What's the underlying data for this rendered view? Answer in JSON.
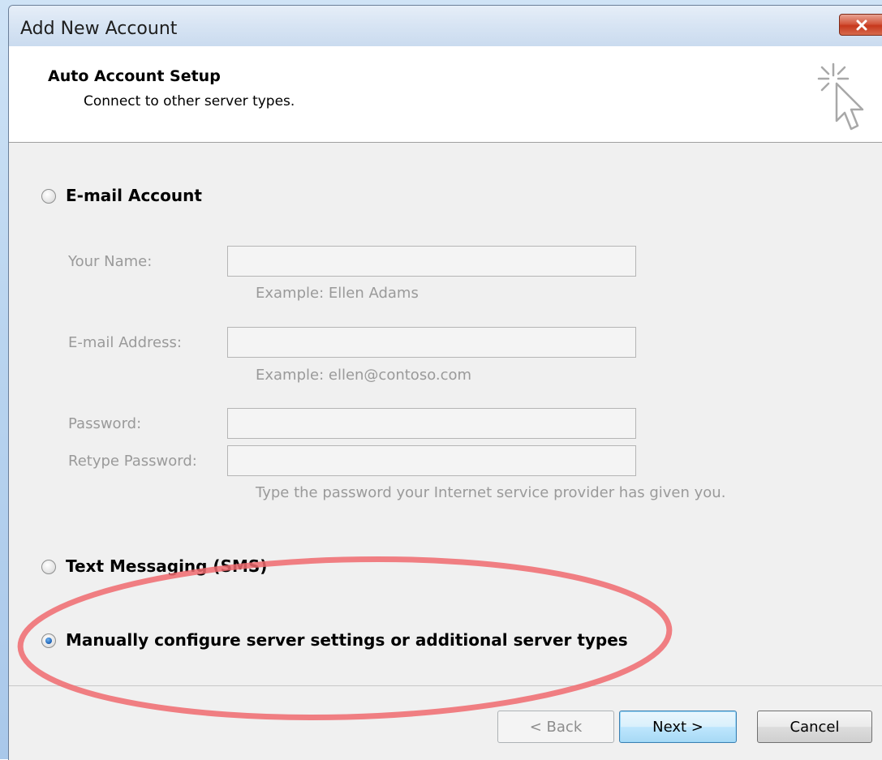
{
  "window": {
    "title": "Add New Account",
    "close_icon": "close-icon"
  },
  "header": {
    "title": "Auto Account Setup",
    "subtitle": "Connect to other server types.",
    "icon": "wizard-cursor-icon"
  },
  "options": {
    "email_account": {
      "label": "E-mail Account",
      "selected": false
    },
    "sms": {
      "label": "Text Messaging (SMS)",
      "selected": false
    },
    "manual": {
      "label": "Manually configure server settings or additional server types",
      "selected": true
    }
  },
  "form": {
    "your_name": {
      "label": "Your Name:",
      "value": "",
      "hint": "Example: Ellen Adams"
    },
    "email_address": {
      "label": "E-mail Address:",
      "value": "",
      "hint": "Example: ellen@contoso.com"
    },
    "password": {
      "label": "Password:",
      "value": ""
    },
    "retype_password": {
      "label": "Retype Password:",
      "value": "",
      "hint": "Type the password your Internet service provider has given you."
    }
  },
  "buttons": {
    "back": "< Back",
    "next": "Next >",
    "cancel": "Cancel"
  },
  "colors": {
    "annotation": "#f06a6e",
    "window_background": "#f0f0f0",
    "disabled_text": "#9a9a9a"
  }
}
